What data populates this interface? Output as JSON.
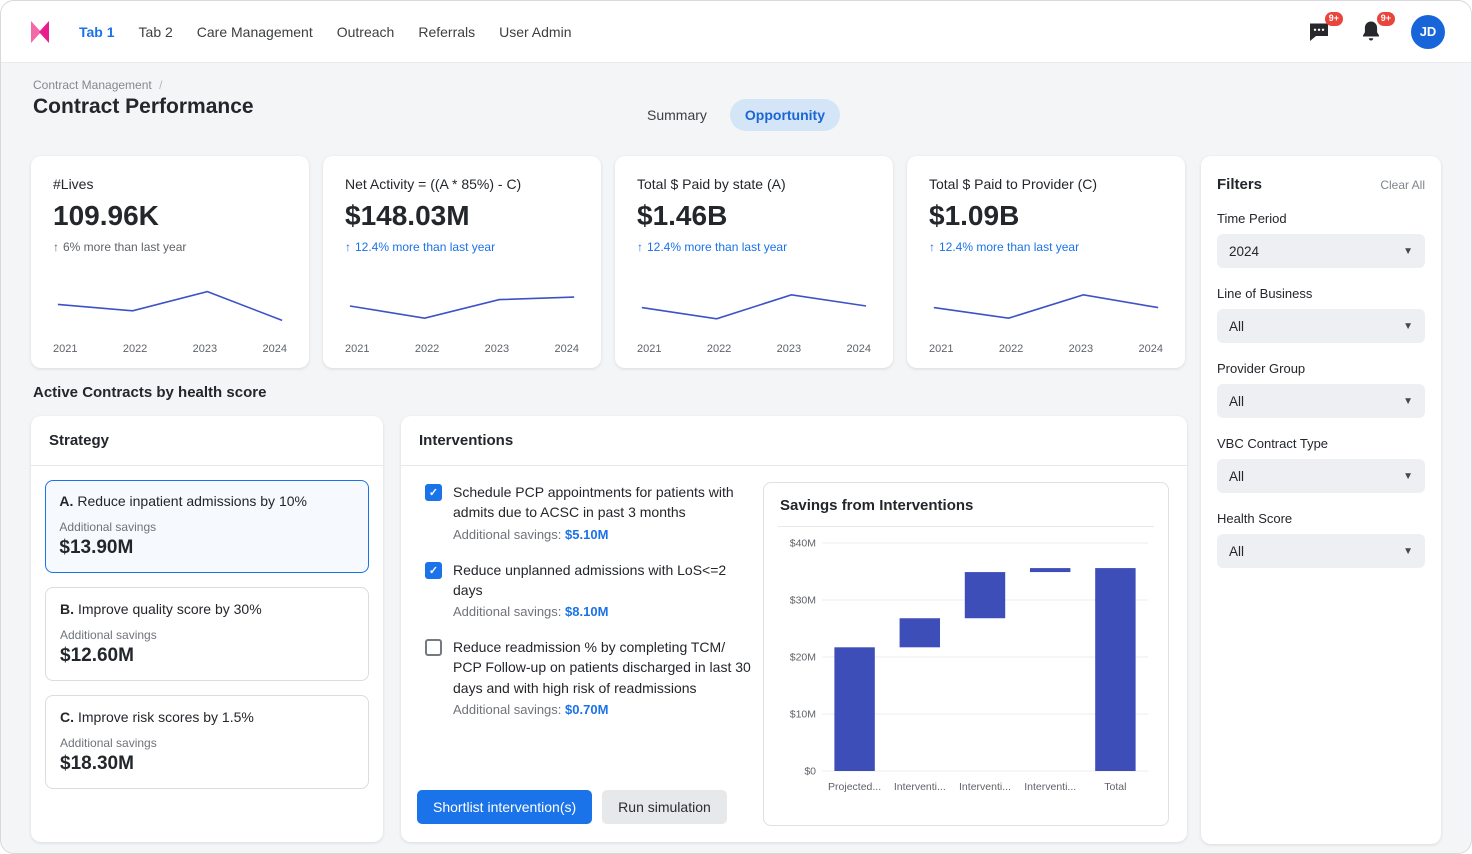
{
  "icons": {
    "up_arrow": "↑",
    "chevron_down": "▼",
    "breadcrumb_sep": "/",
    "check": "✓"
  },
  "nav": {
    "tabs": [
      {
        "label": "Tab 1",
        "active": true
      },
      {
        "label": "Tab 2",
        "active": false
      },
      {
        "label": "Care Management",
        "active": false
      },
      {
        "label": "Outreach",
        "active": false
      },
      {
        "label": "Referrals",
        "active": false
      },
      {
        "label": "User Admin",
        "active": false
      }
    ],
    "chat_badge": "9+",
    "notifications_badge": "9+",
    "avatar_initials": "JD"
  },
  "header": {
    "breadcrumb": "Contract Management",
    "title": "Contract Performance",
    "toggle": {
      "summary": "Summary",
      "opportunity": "Opportunity",
      "active": "Opportunity"
    }
  },
  "kpis": [
    {
      "label": "#Lives",
      "value": "109.96K",
      "delta": "6% more than last year",
      "delta_color": "#5f6368",
      "years": [
        "2021",
        "2022",
        "2023",
        "2024"
      ],
      "trend": [
        0.55,
        0.35,
        0.95,
        0.05
      ]
    },
    {
      "label": "Net Activity = ((A * 85%) - C)",
      "value": "$148.03M",
      "delta": "12.4% more than last year",
      "delta_color": "#1a73e8",
      "years": [
        "2021",
        "2022",
        "2023",
        "2024"
      ],
      "trend": [
        0.5,
        0.12,
        0.7,
        0.78
      ]
    },
    {
      "label": "Total $ Paid by state (A)",
      "value": "$1.46B",
      "delta": "12.4% more than last year",
      "delta_color": "#1a73e8",
      "years": [
        "2021",
        "2022",
        "2023",
        "2024"
      ],
      "trend": [
        0.45,
        0.1,
        0.85,
        0.5
      ]
    },
    {
      "label": "Total $ Paid to Provider  (C)",
      "value": "$1.09B",
      "delta": "12.4% more than last year",
      "delta_color": "#1a73e8",
      "years": [
        "2021",
        "2022",
        "2023",
        "2024"
      ],
      "trend": [
        0.45,
        0.12,
        0.85,
        0.45
      ]
    }
  ],
  "filters": {
    "title": "Filters",
    "clear_all": "Clear All",
    "groups": [
      {
        "label": "Time Period",
        "value": "2024"
      },
      {
        "label": "Line of Business",
        "value": "All"
      },
      {
        "label": "Provider Group",
        "value": "All"
      },
      {
        "label": "VBC Contract Type",
        "value": "All"
      },
      {
        "label": "Health Score",
        "value": "All"
      }
    ]
  },
  "section_title": "Active Contracts by health score",
  "strategy": {
    "title": "Strategy",
    "cards": [
      {
        "letter": "A.",
        "text": "Reduce inpatient admissions by 10%",
        "savings_label": "Additional savings",
        "savings": "$13.90M",
        "selected": true
      },
      {
        "letter": "B.",
        "text": "Improve quality score by 30%",
        "savings_label": "Additional savings",
        "savings": "$12.60M",
        "selected": false
      },
      {
        "letter": "C.",
        "text": "Improve risk scores by 1.5%",
        "savings_label": "Additional savings",
        "savings": "$18.30M",
        "selected": false
      }
    ]
  },
  "interventions": {
    "title": "Interventions",
    "savings_label": "Additional savings:",
    "items": [
      {
        "checked": true,
        "text": "Schedule PCP appointments for patients with admits due to ACSC in past 3 months",
        "savings": "$5.10M"
      },
      {
        "checked": true,
        "text": "Reduce unplanned admissions with LoS<=2 days",
        "savings": "$8.10M"
      },
      {
        "checked": false,
        "text": "Reduce readmission % by completing TCM/ PCP Follow-up on patients discharged in last 30 days and with high risk of readmissions",
        "savings": "$0.70M"
      }
    ],
    "shortlist_button": "Shortlist intervention(s)",
    "run_button": "Run simulation"
  },
  "chart_data": {
    "type": "waterfall",
    "title": "Savings from Interventions",
    "categories": [
      "Projected...",
      "Interventi...",
      "Interventi...",
      "Interventi...",
      "Total"
    ],
    "series": [
      {
        "name": "Savings ($M)",
        "segments": [
          [
            0,
            21.7
          ],
          [
            21.7,
            26.8
          ],
          [
            26.8,
            34.9
          ],
          [
            34.9,
            35.6
          ],
          [
            0,
            35.6
          ]
        ]
      }
    ],
    "yticks": [
      {
        "label": "$0",
        "v": 0
      },
      {
        "label": "$10M",
        "v": 10
      },
      {
        "label": "$20M",
        "v": 20
      },
      {
        "label": "$30M",
        "v": 30
      },
      {
        "label": "$40M",
        "v": 40
      }
    ],
    "ylim": [
      0,
      40
    ],
    "grid": true,
    "legend": false,
    "bar_color": "#3e4eb8",
    "line_color": "#3d52c6"
  }
}
